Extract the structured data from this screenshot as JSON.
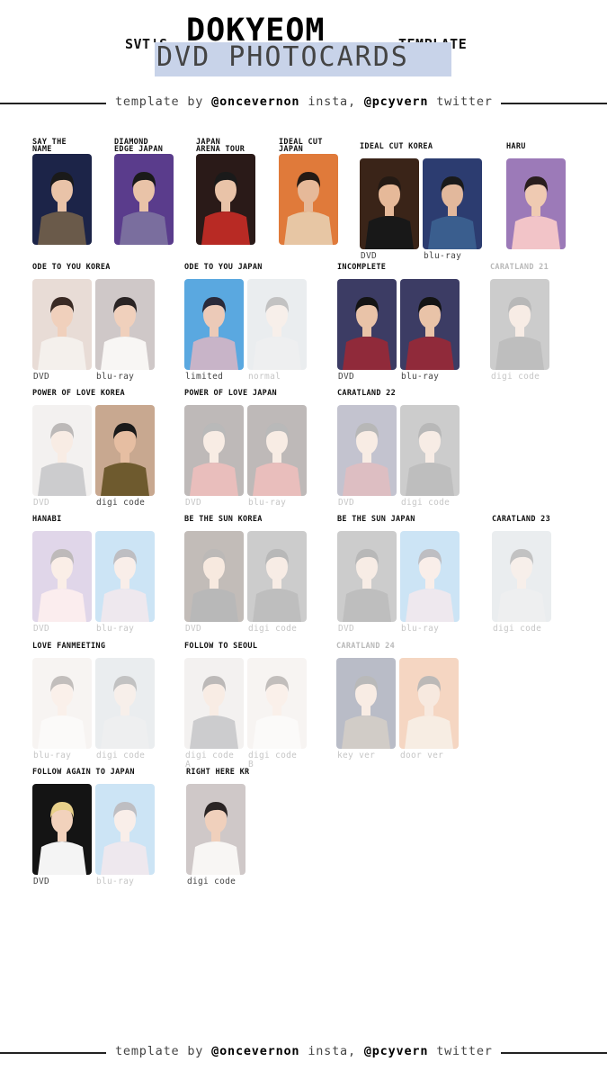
{
  "header": {
    "prefix": "SVT'S",
    "member": "DOKYEOM",
    "suffix": "TEMPLATE",
    "subtitle": "DVD PHOTOCARDS",
    "highlight_color": "#c8d3e9"
  },
  "credit": {
    "lead": "template by",
    "insta_handle": "@oncevernon",
    "insta_word": "insta,",
    "twitter_handle": "@pcyvern",
    "twitter_word": "twitter"
  },
  "sections": [
    {
      "title": "SAY THE\nNAME",
      "collected": true,
      "cards": [
        {
          "label": "",
          "collected": true,
          "palette": "navy"
        }
      ]
    },
    {
      "title": "DIAMOND\nEDGE JAPAN",
      "collected": true,
      "cards": [
        {
          "label": "",
          "collected": true,
          "palette": "purple"
        }
      ]
    },
    {
      "title": "JAPAN\nARENA TOUR",
      "collected": true,
      "cards": [
        {
          "label": "",
          "collected": true,
          "palette": "red"
        }
      ]
    },
    {
      "title": "IDEAL CUT\nJAPAN",
      "collected": true,
      "cards": [
        {
          "label": "",
          "collected": true,
          "palette": "orange"
        }
      ]
    },
    {
      "title": "IDEAL CUT KOREA",
      "collected": true,
      "cards": [
        {
          "label": "DVD",
          "collected": true,
          "palette": "brown"
        },
        {
          "label": "blu-ray",
          "collected": true,
          "palette": "denim"
        }
      ]
    },
    {
      "title": "HARU",
      "collected": true,
      "cards": [
        {
          "label": "",
          "collected": true,
          "palette": "pink"
        }
      ]
    },
    {
      "title": "ODE TO YOU KOREA",
      "collected": true,
      "cards": [
        {
          "label": "DVD",
          "collected": true,
          "palette": "light"
        },
        {
          "label": "blu-ray",
          "collected": true,
          "palette": "white"
        }
      ]
    },
    {
      "title": "ODE TO YOU JAPAN",
      "collected": true,
      "cards": [
        {
          "label": "limited",
          "collected": true,
          "palette": "sky"
        },
        {
          "label": "normal",
          "collected": false,
          "palette": "grey"
        }
      ]
    },
    {
      "title": "INCOMPLETE",
      "collected": true,
      "cards": [
        {
          "label": "DVD",
          "collected": true,
          "palette": "check"
        },
        {
          "label": "blu-ray",
          "collected": true,
          "palette": "check"
        }
      ]
    },
    {
      "title": "CARATLAND 21",
      "collected": false,
      "cards": [
        {
          "label": "digi code",
          "collected": false,
          "palette": "dark"
        }
      ]
    },
    {
      "title": "POWER OF LOVE KOREA",
      "collected": true,
      "cards": [
        {
          "label": "DVD",
          "collected": false,
          "palette": "suit"
        },
        {
          "label": "digi code",
          "collected": true,
          "palette": "olive"
        }
      ]
    },
    {
      "title": "POWER OF LOVE JAPAN",
      "collected": true,
      "cards": [
        {
          "label": "DVD",
          "collected": false,
          "palette": "red"
        },
        {
          "label": "blu-ray",
          "collected": false,
          "palette": "red"
        }
      ]
    },
    {
      "title": "CARATLAND 22",
      "collected": true,
      "cards": [
        {
          "label": "DVD",
          "collected": false,
          "palette": "check"
        },
        {
          "label": "digi code",
          "collected": false,
          "palette": "dark"
        }
      ]
    },
    {
      "title": "HANABI",
      "collected": true,
      "cards": [
        {
          "label": "DVD",
          "collected": false,
          "palette": "pink"
        },
        {
          "label": "blu-ray",
          "collected": false,
          "palette": "sky"
        }
      ]
    },
    {
      "title": "BE THE SUN KOREA",
      "collected": true,
      "cards": [
        {
          "label": "DVD",
          "collected": false,
          "palette": "brown"
        },
        {
          "label": "digi code",
          "collected": false,
          "palette": "dark"
        }
      ]
    },
    {
      "title": "BE THE SUN JAPAN",
      "collected": true,
      "cards": [
        {
          "label": "DVD",
          "collected": false,
          "palette": "dark"
        },
        {
          "label": "blu-ray",
          "collected": false,
          "palette": "sky"
        }
      ]
    },
    {
      "title": "CARATLAND 23",
      "collected": true,
      "cards": [
        {
          "label": "digi code",
          "collected": false,
          "palette": "grey"
        }
      ]
    },
    {
      "title": "LOVE FANMEETING",
      "collected": true,
      "cards": [
        {
          "label": "blu-ray",
          "collected": false,
          "palette": "light"
        },
        {
          "label": "digi code",
          "collected": false,
          "palette": "grey"
        }
      ]
    },
    {
      "title": "FOLLOW TO SEOUL",
      "collected": true,
      "cards": [
        {
          "label": "digi code\nA",
          "collected": false,
          "palette": "suit"
        },
        {
          "label": "digi code\nB",
          "collected": false,
          "palette": "light"
        }
      ]
    },
    {
      "title": "CARATLAND 24",
      "collected": false,
      "cards": [
        {
          "label": "key ver",
          "collected": false,
          "palette": "navy"
        },
        {
          "label": "door ver",
          "collected": false,
          "palette": "orange"
        }
      ]
    },
    {
      "title": "FOLLOW AGAIN TO JAPAN",
      "collected": true,
      "cards": [
        {
          "label": "DVD",
          "collected": true,
          "palette": "blonde"
        },
        {
          "label": "blu-ray",
          "collected": false,
          "palette": "sky"
        }
      ]
    },
    {
      "title": "RIGHT HERE KR",
      "collected": true,
      "cards": [
        {
          "label": "digi code",
          "collected": true,
          "palette": "white"
        }
      ]
    }
  ],
  "palettes": {
    "navy": {
      "bg": "#1c2448",
      "hair": "#1a1a1a",
      "skin": "#e9c3a8",
      "outfit": "#6a5a4a"
    },
    "purple": {
      "bg": "#5a3c8c",
      "hair": "#1a1a1a",
      "skin": "#e9c3a8",
      "outfit": "#7a6e9e"
    },
    "red": {
      "bg": "#2a1a18",
      "hair": "#1a1a1a",
      "skin": "#e9c3a8",
      "outfit": "#b82a24"
    },
    "orange": {
      "bg": "#e07a3a",
      "hair": "#241a14",
      "skin": "#e6b999",
      "outfit": "#e7c6a4"
    },
    "brown": {
      "bg": "#3a2418",
      "hair": "#241a14",
      "skin": "#e6b999",
      "outfit": "#181818"
    },
    "denim": {
      "bg": "#2c3c70",
      "hair": "#1a1a1a",
      "skin": "#e2b89c",
      "outfit": "#3a5e8e"
    },
    "pink": {
      "bg": "#9c7ab8",
      "hair": "#2a1e1e",
      "skin": "#efcab2",
      "outfit": "#f2c4c8"
    },
    "light": {
      "bg": "#e8dcd6",
      "hair": "#3a2a24",
      "skin": "#f0d0bc",
      "outfit": "#f4f0ec"
    },
    "white": {
      "bg": "#cfc8c8",
      "hair": "#2a2424",
      "skin": "#f0d0bc",
      "outfit": "#f8f6f4"
    },
    "sky": {
      "bg": "#5aa8e0",
      "hair": "#2a2a3a",
      "skin": "#eccab8",
      "outfit": "#c8b4c8"
    },
    "grey": {
      "bg": "#bcc4cc",
      "hair": "#3a3a3a",
      "skin": "#e6cdbd",
      "outfit": "#c8ccd0"
    },
    "check": {
      "bg": "#3c3c64",
      "hair": "#141414",
      "skin": "#e9c3a8",
      "outfit": "#902a3a"
    },
    "dark": {
      "bg": "#5a5a5a",
      "hair": "#161616",
      "skin": "#e6c2aa",
      "outfit": "#2a2a2a"
    },
    "suit": {
      "bg": "#d8d4d0",
      "hair": "#241a18",
      "skin": "#e9c3a8",
      "outfit": "#5a5a60"
    },
    "olive": {
      "bg": "#c8a890",
      "hair": "#1a1a1a",
      "skin": "#e6bea2",
      "outfit": "#6e5a2e"
    },
    "blonde": {
      "bg": "#141414",
      "hair": "#e8d08a",
      "skin": "#f2d2bc",
      "outfit": "#f4f4f4"
    }
  }
}
